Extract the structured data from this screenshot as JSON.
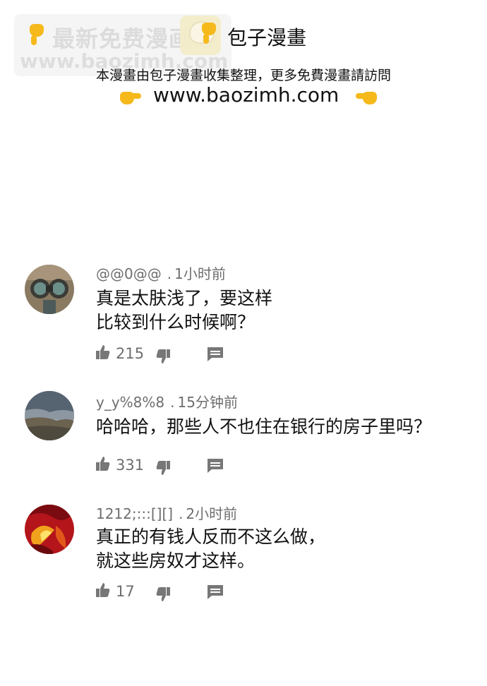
{
  "header": {
    "watermark_line1": "最新免费漫画",
    "watermark_line2": "www.baozimh.com",
    "site_name": "包子漫畫",
    "notice": "本漫畫由包子漫畫收集整理，更多免費漫畫請訪問",
    "url": "www.baozimh.com"
  },
  "comments": [
    {
      "username": "@@0@@",
      "separator": ".",
      "time": "1小时前",
      "lines": [
        "真是太肤浅了，要这样",
        "比较到什么时候啊？"
      ],
      "likes": "215",
      "avatar_icon": "binoculars-avatar"
    },
    {
      "username": "y_y%8%8",
      "separator": ".",
      "time": "15分钟前",
      "lines": [
        "哈哈哈，那些人不也住在银行的房子里吗？"
      ],
      "likes": "331",
      "avatar_icon": "landscape-avatar"
    },
    {
      "username": "1212;:::[][]",
      "separator": ".",
      "time": "2小时前",
      "lines": [
        "真正的有钱人反而不这么做，",
        "就这些房奴才这样。"
      ],
      "likes": "17",
      "avatar_icon": "abstract-red-avatar"
    }
  ],
  "colors": {
    "hand_emoji": "#f6b91b",
    "meta_gray": "#6e6e6e",
    "icon_gray": "#777777"
  }
}
